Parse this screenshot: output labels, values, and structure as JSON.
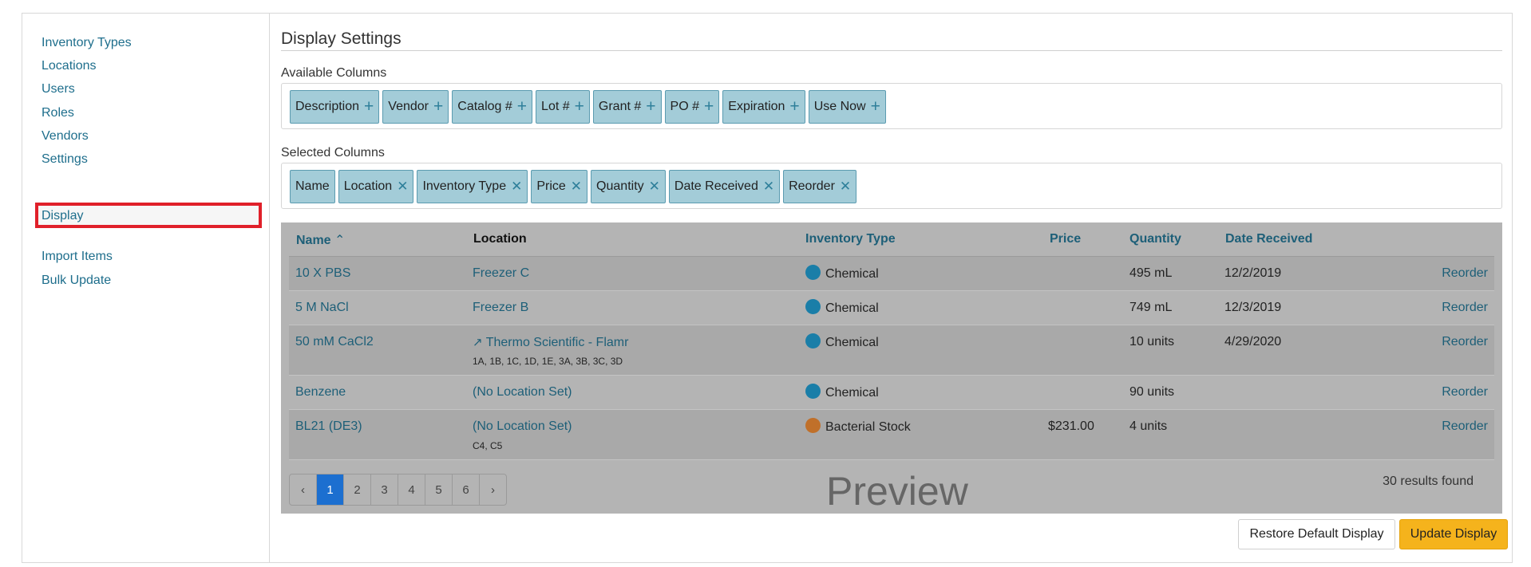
{
  "sidebar": {
    "items": [
      {
        "label": "Inventory Types"
      },
      {
        "label": "Locations"
      },
      {
        "label": "Users"
      },
      {
        "label": "Roles"
      },
      {
        "label": "Vendors"
      },
      {
        "label": "Settings"
      },
      {
        "label": "Display",
        "active": true
      },
      {
        "label": "Import Items"
      },
      {
        "label": "Bulk Update"
      }
    ]
  },
  "main": {
    "title": "Display Settings",
    "available_label": "Available Columns",
    "available": [
      "Description",
      "Vendor",
      "Catalog #",
      "Lot #",
      "Grant #",
      "PO #",
      "Expiration",
      "Use Now"
    ],
    "selected_label": "Selected Columns",
    "selected": [
      "Name",
      "Location",
      "Inventory Type",
      "Price",
      "Quantity",
      "Date Received",
      "Reorder"
    ]
  },
  "icons": {
    "add": "plus-icon",
    "remove": "close-icon",
    "sort": "chevron-up-circle-icon",
    "external": "external-link-icon"
  },
  "colors": {
    "chemical": "#1a7ea8",
    "bacterial": "#c0702a",
    "accent": "#1e6e8c",
    "update_button": "#f5b31c"
  },
  "preview": {
    "headers": {
      "name": "Name",
      "location": "Location",
      "type": "Inventory Type",
      "price": "Price",
      "quantity": "Quantity",
      "date": "Date Received"
    },
    "rows": [
      {
        "name": "10 X PBS",
        "location": "Freezer C",
        "sublocation": "",
        "type": "Chemical",
        "price": "",
        "quantity": "495 mL",
        "date": "12/2/2019",
        "action": "Reorder"
      },
      {
        "name": "5 M NaCl",
        "location": "Freezer B",
        "sublocation": "",
        "type": "Chemical",
        "price": "",
        "quantity": "749 mL",
        "date": "12/3/2019",
        "action": "Reorder"
      },
      {
        "name": "50 mM CaCl2",
        "location": "Thermo Scientific - Flamr",
        "sublocation": "1A, 1B, 1C, 1D, 1E, 3A, 3B, 3C, 3D",
        "type": "Chemical",
        "price": "",
        "quantity": "10 units",
        "date": "4/29/2020",
        "action": "Reorder"
      },
      {
        "name": "Benzene",
        "location": "(No Location Set)",
        "sublocation": "",
        "type": "Chemical",
        "price": "",
        "quantity": "90 units",
        "date": "",
        "action": "Reorder"
      },
      {
        "name": "BL21 (DE3)",
        "location": "(No Location Set)",
        "sublocation": "C4, C5",
        "type": "Bacterial Stock",
        "price": "$231.00",
        "quantity": "4 units",
        "date": "",
        "action": "Reorder"
      }
    ],
    "pagination": {
      "prev": "‹",
      "pages": [
        "1",
        "2",
        "3",
        "4",
        "5",
        "6"
      ],
      "next": "›",
      "current": "1"
    },
    "watermark": "Preview",
    "results": "30 results found"
  },
  "buttons": {
    "restore": "Restore Default Display",
    "update": "Update Display"
  }
}
